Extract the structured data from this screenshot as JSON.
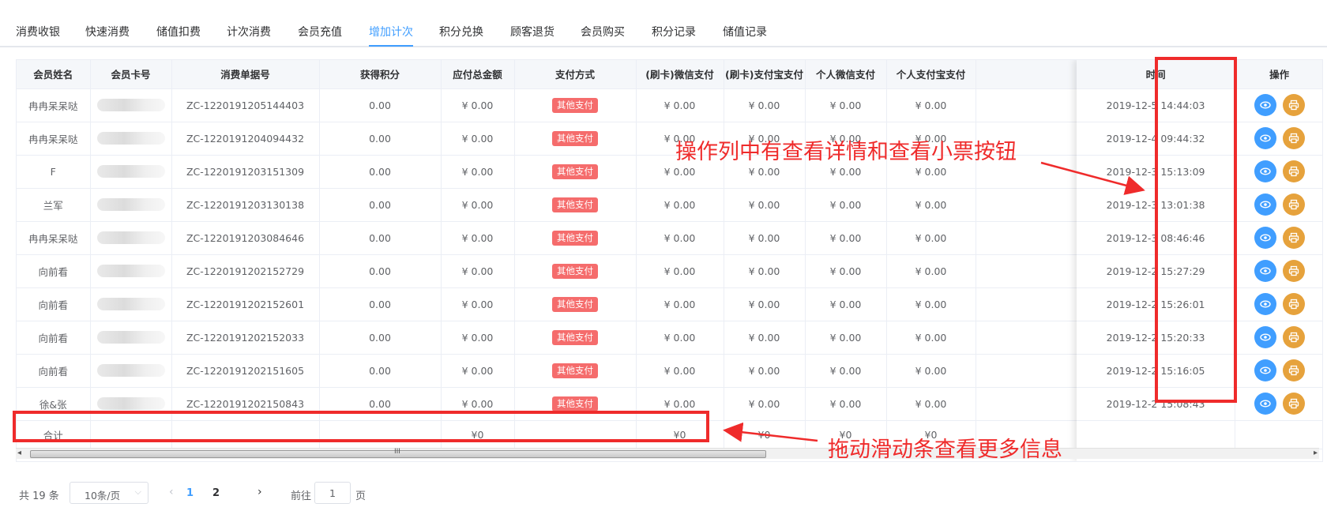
{
  "tabs": [
    {
      "label": "消费收银",
      "active": false
    },
    {
      "label": "快速消费",
      "active": false
    },
    {
      "label": "储值扣费",
      "active": false
    },
    {
      "label": "计次消费",
      "active": false
    },
    {
      "label": "会员充值",
      "active": false
    },
    {
      "label": "增加计次",
      "active": true
    },
    {
      "label": "积分兑换",
      "active": false
    },
    {
      "label": "顾客退货",
      "active": false
    },
    {
      "label": "会员购买",
      "active": false
    },
    {
      "label": "积分记录",
      "active": false
    },
    {
      "label": "储值记录",
      "active": false
    }
  ],
  "table": {
    "headers": [
      "会员姓名",
      "会员卡号",
      "消费单据号",
      "获得积分",
      "应付总金额",
      "支付方式",
      "(刷卡)微信支付",
      "(刷卡)支付宝支付",
      "个人微信支付",
      "个人支付宝支付",
      "时间",
      "操作"
    ],
    "rows": [
      {
        "name": "冉冉呆呆哒",
        "order": "ZC-1220191205144403",
        "points": "0.00",
        "total": "¥ 0.00",
        "pay": "其他支付",
        "wx_card": "¥ 0.00",
        "ali_card": "¥ 0.00",
        "wx_personal": "¥ 0.00",
        "ali_personal": "¥ 0.00",
        "time": "2019-12-5 14:44:03"
      },
      {
        "name": "冉冉呆呆哒",
        "order": "ZC-1220191204094432",
        "points": "0.00",
        "total": "¥ 0.00",
        "pay": "其他支付",
        "wx_card": "¥ 0.00",
        "ali_card": "¥ 0.00",
        "wx_personal": "¥ 0.00",
        "ali_personal": "¥ 0.00",
        "time": "2019-12-4 09:44:32"
      },
      {
        "name": "F",
        "order": "ZC-1220191203151309",
        "points": "0.00",
        "total": "¥ 0.00",
        "pay": "其他支付",
        "wx_card": "¥ 0.00",
        "ali_card": "¥ 0.00",
        "wx_personal": "¥ 0.00",
        "ali_personal": "¥ 0.00",
        "time": "2019-12-3 15:13:09"
      },
      {
        "name": "兰军",
        "order": "ZC-1220191203130138",
        "points": "0.00",
        "total": "¥ 0.00",
        "pay": "其他支付",
        "wx_card": "¥ 0.00",
        "ali_card": "¥ 0.00",
        "wx_personal": "¥ 0.00",
        "ali_personal": "¥ 0.00",
        "time": "2019-12-3 13:01:38"
      },
      {
        "name": "冉冉呆呆哒",
        "order": "ZC-1220191203084646",
        "points": "0.00",
        "total": "¥ 0.00",
        "pay": "其他支付",
        "wx_card": "¥ 0.00",
        "ali_card": "¥ 0.00",
        "wx_personal": "¥ 0.00",
        "ali_personal": "¥ 0.00",
        "time": "2019-12-3 08:46:46"
      },
      {
        "name": "向前看",
        "order": "ZC-1220191202152729",
        "points": "0.00",
        "total": "¥ 0.00",
        "pay": "其他支付",
        "wx_card": "¥ 0.00",
        "ali_card": "¥ 0.00",
        "wx_personal": "¥ 0.00",
        "ali_personal": "¥ 0.00",
        "time": "2019-12-2 15:27:29"
      },
      {
        "name": "向前看",
        "order": "ZC-1220191202152601",
        "points": "0.00",
        "total": "¥ 0.00",
        "pay": "其他支付",
        "wx_card": "¥ 0.00",
        "ali_card": "¥ 0.00",
        "wx_personal": "¥ 0.00",
        "ali_personal": "¥ 0.00",
        "time": "2019-12-2 15:26:01"
      },
      {
        "name": "向前看",
        "order": "ZC-1220191202152033",
        "points": "0.00",
        "total": "¥ 0.00",
        "pay": "其他支付",
        "wx_card": "¥ 0.00",
        "ali_card": "¥ 0.00",
        "wx_personal": "¥ 0.00",
        "ali_personal": "¥ 0.00",
        "time": "2019-12-2 15:20:33"
      },
      {
        "name": "向前看",
        "order": "ZC-1220191202151605",
        "points": "0.00",
        "total": "¥ 0.00",
        "pay": "其他支付",
        "wx_card": "¥ 0.00",
        "ali_card": "¥ 0.00",
        "wx_personal": "¥ 0.00",
        "ali_personal": "¥ 0.00",
        "time": "2019-12-2 15:16:05"
      },
      {
        "name": "徐&张",
        "order": "ZC-1220191202150843",
        "points": "0.00",
        "total": "¥ 0.00",
        "pay": "其他支付",
        "wx_card": "¥ 0.00",
        "ali_card": "¥ 0.00",
        "wx_personal": "¥ 0.00",
        "ali_personal": "¥ 0.00",
        "time": "2019-12-2 15:08:43"
      }
    ],
    "summary": {
      "label": "合计",
      "total": "¥0",
      "wx_card": "¥0",
      "ali_card": "¥0",
      "wx_personal": "¥0",
      "ali_personal": "¥0"
    }
  },
  "scrollbar": {
    "grip": "III"
  },
  "pagination": {
    "total": "共 19 条",
    "page_size": "10条/页",
    "pages": [
      "1",
      "2"
    ],
    "current": "1",
    "goto_label": "前往",
    "goto_value": "1",
    "unit": "页"
  },
  "annotations": {
    "ops_note": "操作列中有查看详情和查看小票按钮",
    "scroll_note": "拖动滑动条查看更多信息",
    "color": "#ef2b2b"
  },
  "icons": {
    "view": "eye-icon",
    "print": "printer-icon"
  }
}
